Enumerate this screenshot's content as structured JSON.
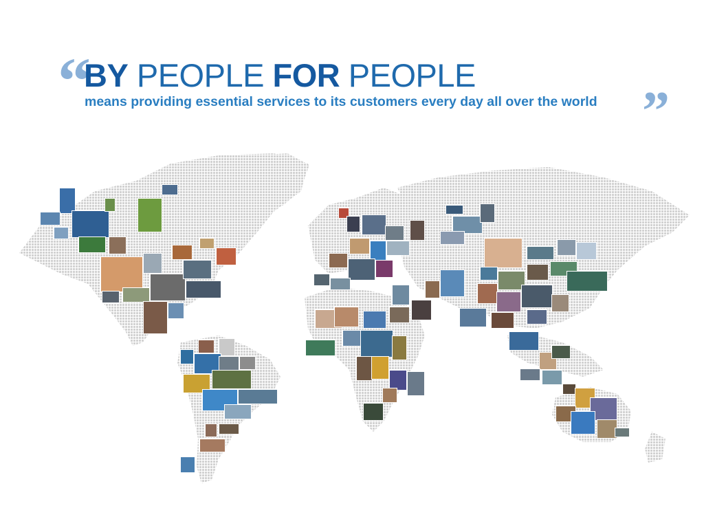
{
  "header": {
    "quote_open": "“",
    "quote_close": "”",
    "title_part1": "BY",
    "title_part2": " PEOPLE ",
    "title_part3": "FOR",
    "title_part4": " PEOPLE",
    "subtitle": "means providing essential services to its customers every day all over the world"
  },
  "colors": {
    "primary_blue": "#1559a0",
    "accent_blue": "#2a7ec1",
    "quote_blue": "#8ab0d8",
    "map_dots": "#cfcfcf"
  },
  "map": {
    "style": "dotted-world-map",
    "photo_collage": "people-photos-over-continents"
  }
}
